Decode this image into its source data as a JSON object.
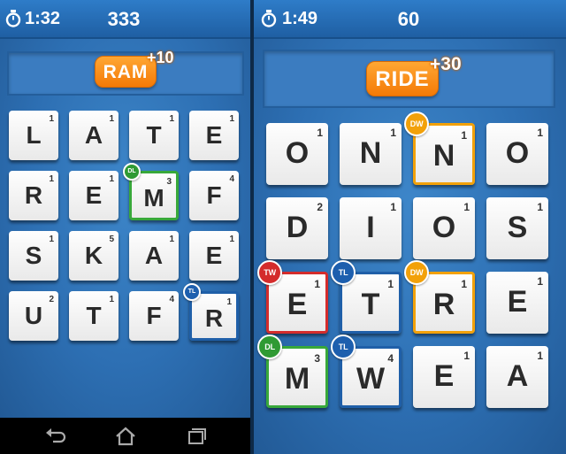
{
  "left": {
    "timer": "1:32",
    "score": "333",
    "word": "RAM",
    "bonus": "+10",
    "tiles": [
      {
        "letter": "L",
        "points": "1",
        "bonus": ""
      },
      {
        "letter": "A",
        "points": "1",
        "bonus": ""
      },
      {
        "letter": "T",
        "points": "1",
        "bonus": ""
      },
      {
        "letter": "E",
        "points": "1",
        "bonus": ""
      },
      {
        "letter": "R",
        "points": "1",
        "bonus": ""
      },
      {
        "letter": "E",
        "points": "1",
        "bonus": ""
      },
      {
        "letter": "M",
        "points": "3",
        "bonus": "DL"
      },
      {
        "letter": "F",
        "points": "4",
        "bonus": ""
      },
      {
        "letter": "S",
        "points": "1",
        "bonus": ""
      },
      {
        "letter": "K",
        "points": "5",
        "bonus": ""
      },
      {
        "letter": "A",
        "points": "1",
        "bonus": ""
      },
      {
        "letter": "E",
        "points": "1",
        "bonus": ""
      },
      {
        "letter": "U",
        "points": "2",
        "bonus": ""
      },
      {
        "letter": "T",
        "points": "1",
        "bonus": ""
      },
      {
        "letter": "F",
        "points": "4",
        "bonus": ""
      },
      {
        "letter": "R",
        "points": "1",
        "bonus": "TL"
      }
    ]
  },
  "right": {
    "timer": "1:49",
    "score": "60",
    "word": "RIDE",
    "bonus": "+30",
    "tiles": [
      {
        "letter": "O",
        "points": "1",
        "bonus": ""
      },
      {
        "letter": "N",
        "points": "1",
        "bonus": ""
      },
      {
        "letter": "N",
        "points": "1",
        "bonus": "DW"
      },
      {
        "letter": "O",
        "points": "1",
        "bonus": ""
      },
      {
        "letter": "D",
        "points": "2",
        "bonus": ""
      },
      {
        "letter": "I",
        "points": "1",
        "bonus": ""
      },
      {
        "letter": "O",
        "points": "1",
        "bonus": ""
      },
      {
        "letter": "S",
        "points": "1",
        "bonus": ""
      },
      {
        "letter": "E",
        "points": "1",
        "bonus": "TW"
      },
      {
        "letter": "T",
        "points": "1",
        "bonus": "TL"
      },
      {
        "letter": "R",
        "points": "1",
        "bonus": "DW"
      },
      {
        "letter": "E",
        "points": "1",
        "bonus": ""
      },
      {
        "letter": "M",
        "points": "3",
        "bonus": "DL"
      },
      {
        "letter": "W",
        "points": "4",
        "bonus": "TL"
      },
      {
        "letter": "E",
        "points": "1",
        "bonus": ""
      },
      {
        "letter": "A",
        "points": "1",
        "bonus": ""
      }
    ]
  },
  "icons": {
    "timer": "stopwatch-icon",
    "nav": [
      "back-icon",
      "home-icon",
      "recent-apps-icon"
    ]
  },
  "colors": {
    "background": "#2d6fb3",
    "word_pill": "#f47a07",
    "dl": "#2f9a33",
    "dw": "#f2a10a",
    "tl": "#1d5fae",
    "tw": "#d42c2c"
  }
}
